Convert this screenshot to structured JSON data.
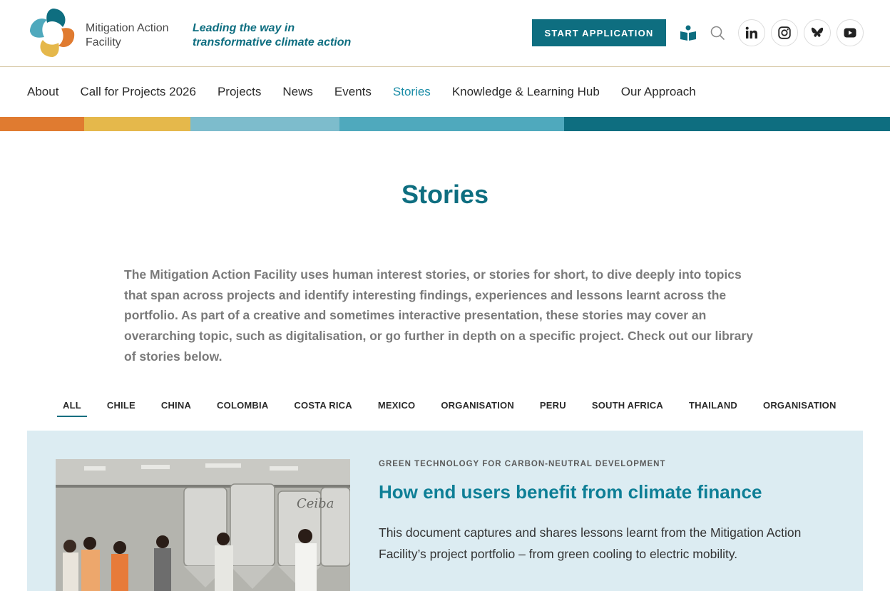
{
  "header": {
    "logo_text_line1": "Mitigation Action",
    "logo_text_line2": "Facility",
    "tagline_line1": "Leading the way in",
    "tagline_line2": "transformative climate action",
    "cta_label": "START APPLICATION",
    "icons": [
      "book-reader-icon",
      "search-icon",
      "linkedin-icon",
      "instagram-icon",
      "bluesky-icon",
      "youtube-icon"
    ]
  },
  "nav": {
    "items": [
      {
        "label": "About"
      },
      {
        "label": "Call for Projects 2026"
      },
      {
        "label": "Projects"
      },
      {
        "label": "News"
      },
      {
        "label": "Events"
      },
      {
        "label": "Stories",
        "active": true
      },
      {
        "label": "Knowledge & Learning Hub"
      },
      {
        "label": "Our Approach"
      }
    ]
  },
  "colors": {
    "primary": "#0e6e80",
    "accent": "#1a8ca6",
    "stripe": [
      "#e07b30",
      "#e5b84b",
      "#7dbccc",
      "#4fa9bd",
      "#0e6e80"
    ]
  },
  "page": {
    "title": "Stories",
    "intro": "The Mitigation Action Facility uses human interest stories, or stories for short, to dive deeply into topics that span across projects and identify interesting findings, experiences and lessons learnt across the portfolio. As part of a creative and sometimes interactive presentation, these stories may cover an overarching topic, such as digitalisation, or go further in depth on a specific project. Check out our library of stories below."
  },
  "filters": {
    "tabs": [
      "ALL",
      "CHILE",
      "CHINA",
      "COLOMBIA",
      "COSTA RICA",
      "MEXICO",
      "ORGANISATION",
      "PERU",
      "SOUTH AFRICA",
      "THAILAND",
      "ORGANISATION"
    ],
    "active": "ALL"
  },
  "feature": {
    "kicker": "GREEN TECHNOLOGY FOR CARBON-NEUTRAL DEVELOPMENT",
    "title": "How end users benefit from climate finance",
    "text": "This document captures and shares lessons learnt from the Mitigation Action Facility’s project portfolio – from green cooling to electric mobility.",
    "image_text": "Ceiba"
  }
}
